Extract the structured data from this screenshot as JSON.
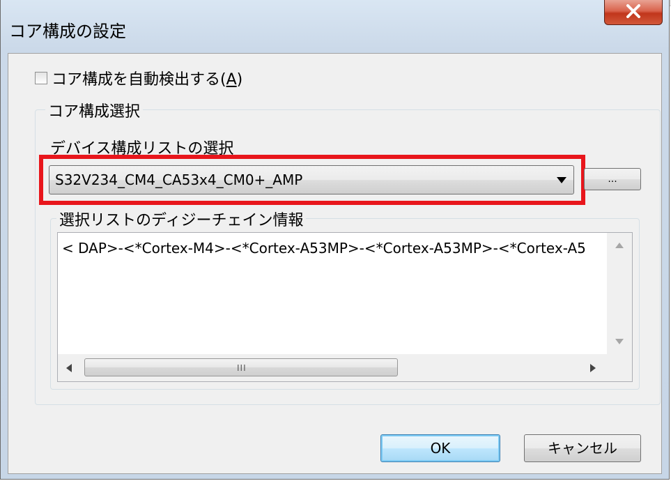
{
  "window": {
    "title": "コア構成の設定",
    "close_icon": "close-icon"
  },
  "auto_detect": {
    "label": "コア構成を自動検出する(",
    "accelerator": "A",
    "label_end": ")",
    "checked": false
  },
  "core_group": {
    "legend": "コア構成選択",
    "device_list_label": "デバイス構成リストの選択",
    "combo_value": "S32V234_CM4_CA53x4_CM0+_AMP",
    "browse_label": "...",
    "highlight_color": "#e8161c"
  },
  "daisy_group": {
    "legend": "選択リストのディジーチェイン情報",
    "text": "< DAP>-<*Cortex-M4>-<*Cortex-A53MP>-<*Cortex-A53MP>-<*Cortex-A5",
    "hscroll_grip": "III"
  },
  "buttons": {
    "ok": "OK",
    "cancel": "キャンセル"
  }
}
